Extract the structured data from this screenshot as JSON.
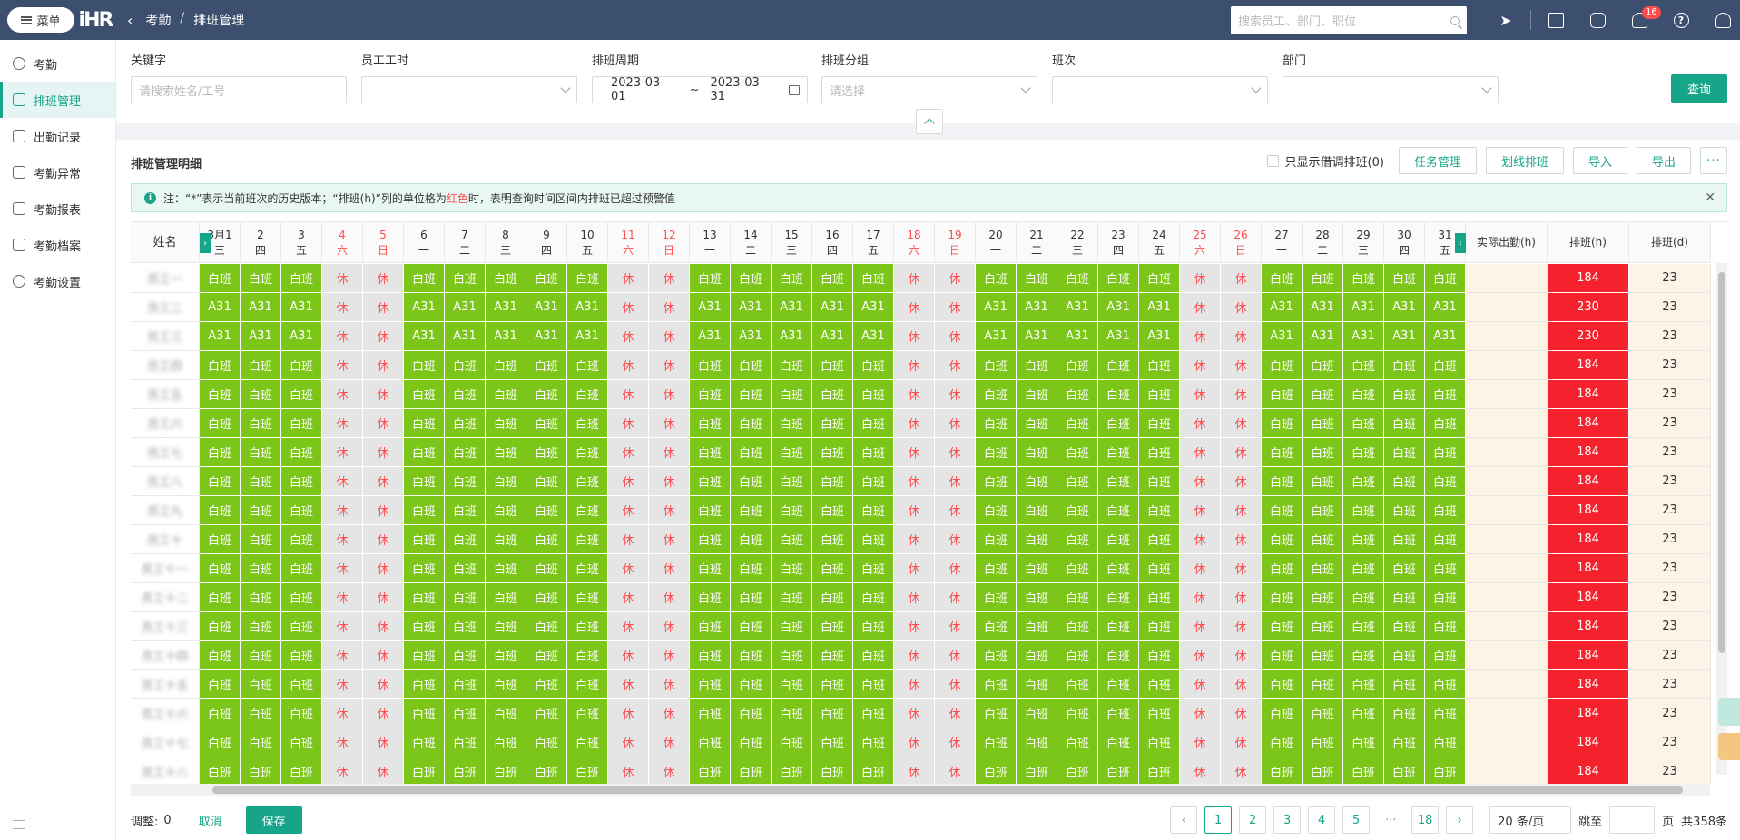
{
  "topbar": {
    "menu_label": "菜单",
    "logo_text": "iHR",
    "breadcrumb": [
      "考勤",
      "排班管理"
    ],
    "breadcrumb_sep": "/",
    "search_placeholder": "搜索员工、部门、职位",
    "notification_count": "16",
    "icons": [
      "pin-icon",
      "qrcode-icon",
      "contacts-icon",
      "bell-icon",
      "help-icon",
      "user-icon"
    ]
  },
  "sidebar": {
    "items": [
      {
        "label": "考勤",
        "icon": "clock-icon",
        "active": false
      },
      {
        "label": "排班管理",
        "icon": "schedule-icon",
        "active": true
      },
      {
        "label": "出勤记录",
        "icon": "record-icon",
        "active": false
      },
      {
        "label": "考勤异常",
        "icon": "alert-icon",
        "active": false
      },
      {
        "label": "考勤报表",
        "icon": "chart-icon",
        "active": false
      },
      {
        "label": "考勤档案",
        "icon": "archive-icon",
        "active": false
      },
      {
        "label": "考勤设置",
        "icon": "settings-icon",
        "active": false
      }
    ]
  },
  "filters": {
    "keyword_label": "关键字",
    "keyword_placeholder": "请搜索姓名/工号",
    "worktime_label": "员工工时",
    "period_label": "排班周期",
    "period_start": "2023-03-01",
    "period_sep": "~",
    "period_end": "2023-03-31",
    "group_label": "排班分组",
    "group_placeholder": "请选择",
    "shift_label": "班次",
    "dept_label": "部门",
    "query_label": "查询"
  },
  "main": {
    "title": "排班管理明细",
    "only_borrowed_label": "只显示借调排班(0)",
    "buttons": [
      "任务管理",
      "划线排班",
      "导入",
      "导出"
    ],
    "more_label": "···",
    "notice_prefix": "注：“*”表示当前班次的历史版本；“排班(h)”列的单位格为",
    "notice_red": "红色",
    "notice_suffix": "时，表明查询时间区间内排班已超过预警值"
  },
  "table": {
    "name_header": "姓名",
    "month_label": "3月",
    "actual_header": "实际出勤(h)",
    "plan_header": "排班(h)",
    "plan_days_header": "排班(d)",
    "days": [
      {
        "d": "1",
        "w": "三"
      },
      {
        "d": "2",
        "w": "四"
      },
      {
        "d": "3",
        "w": "五"
      },
      {
        "d": "4",
        "w": "六"
      },
      {
        "d": "5",
        "w": "日"
      },
      {
        "d": "6",
        "w": "一"
      },
      {
        "d": "7",
        "w": "二"
      },
      {
        "d": "8",
        "w": "三"
      },
      {
        "d": "9",
        "w": "四"
      },
      {
        "d": "10",
        "w": "五"
      },
      {
        "d": "11",
        "w": "六"
      },
      {
        "d": "12",
        "w": "日"
      },
      {
        "d": "13",
        "w": "一"
      },
      {
        "d": "14",
        "w": "二"
      },
      {
        "d": "15",
        "w": "三"
      },
      {
        "d": "16",
        "w": "四"
      },
      {
        "d": "17",
        "w": "五"
      },
      {
        "d": "18",
        "w": "六"
      },
      {
        "d": "19",
        "w": "日"
      },
      {
        "d": "20",
        "w": "一"
      },
      {
        "d": "21",
        "w": "二"
      },
      {
        "d": "22",
        "w": "三"
      },
      {
        "d": "23",
        "w": "四"
      },
      {
        "d": "24",
        "w": "五"
      },
      {
        "d": "25",
        "w": "六"
      },
      {
        "d": "26",
        "w": "日"
      },
      {
        "d": "27",
        "w": "一"
      },
      {
        "d": "28",
        "w": "二"
      },
      {
        "d": "29",
        "w": "三"
      },
      {
        "d": "30",
        "w": "四"
      },
      {
        "d": "31",
        "w": "五"
      }
    ],
    "weekend_days": [
      4,
      5,
      11,
      12,
      18,
      19,
      25,
      26
    ],
    "rest_label": "休",
    "rows": [
      {
        "name": "员工一",
        "shift": "白班",
        "plan": "184",
        "days": "23"
      },
      {
        "name": "员工二",
        "shift": "A31",
        "plan": "230",
        "days": "23"
      },
      {
        "name": "员工三",
        "shift": "A31",
        "plan": "230",
        "days": "23"
      },
      {
        "name": "员工四",
        "shift": "白班",
        "plan": "184",
        "days": "23"
      },
      {
        "name": "员工五",
        "shift": "白班",
        "plan": "184",
        "days": "23"
      },
      {
        "name": "员工六",
        "shift": "白班",
        "plan": "184",
        "days": "23"
      },
      {
        "name": "员工七",
        "shift": "白班",
        "plan": "184",
        "days": "23"
      },
      {
        "name": "员工八",
        "shift": "白班",
        "plan": "184",
        "days": "23"
      },
      {
        "name": "员工九",
        "shift": "白班",
        "plan": "184",
        "days": "23"
      },
      {
        "name": "员工十",
        "shift": "白班",
        "plan": "184",
        "days": "23"
      },
      {
        "name": "员工十一",
        "shift": "白班",
        "plan": "184",
        "days": "23"
      },
      {
        "name": "员工十二",
        "shift": "白班",
        "plan": "184",
        "days": "23"
      },
      {
        "name": "员工十三",
        "shift": "白班",
        "plan": "184",
        "days": "23"
      },
      {
        "name": "员工十四",
        "shift": "白班",
        "plan": "184",
        "days": "23"
      },
      {
        "name": "员工十五",
        "shift": "白班",
        "plan": "184",
        "days": "23"
      },
      {
        "name": "员工十六",
        "shift": "白班",
        "plan": "184",
        "days": "23"
      },
      {
        "name": "员工十七",
        "shift": "白班",
        "plan": "184",
        "days": "23"
      },
      {
        "name": "员工十八",
        "shift": "白班",
        "plan": "184",
        "days": "23"
      }
    ]
  },
  "footer": {
    "adjust_label": "调整:",
    "adjust_value": "0",
    "cancel_label": "取消",
    "save_label": "保存",
    "pages": [
      "1",
      "2",
      "3",
      "4",
      "5"
    ],
    "dots": "···",
    "last_page": "18",
    "page_size": "20 条/页",
    "jump_label": "跳至",
    "page_unit": "页",
    "total": "共358条"
  },
  "colors": {
    "brand": "#16a589",
    "topbar": "#3c4f6e",
    "work_cell": "#7cc619",
    "rest_cell": "#e5e5e5",
    "warning": "#f5222d"
  }
}
